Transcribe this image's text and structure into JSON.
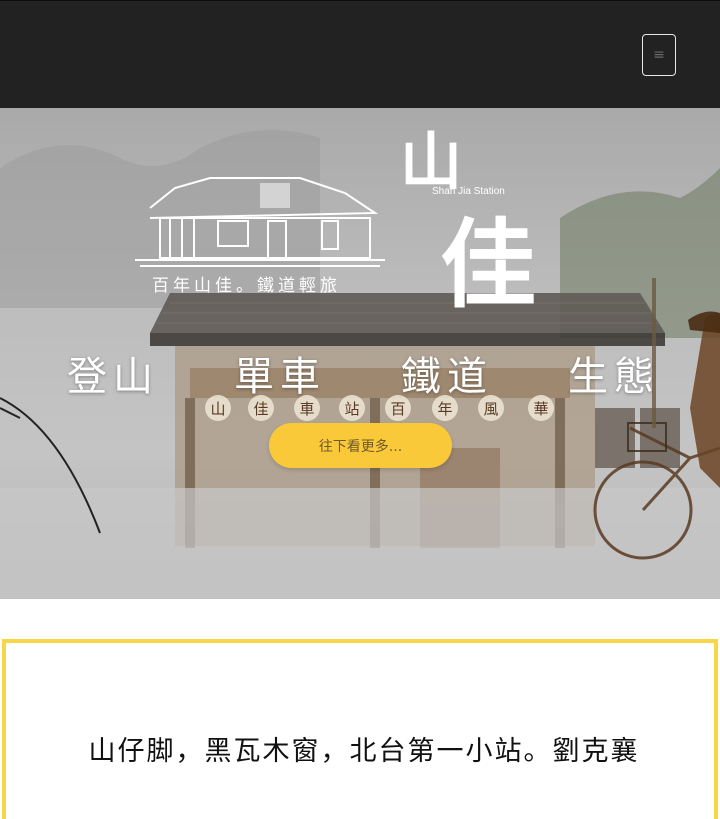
{
  "header": {
    "menu_icon": "hamburger-icon",
    "menu_glyph": "≡"
  },
  "hero": {
    "logo_big_1": "山",
    "logo_big_2": "佳",
    "english_name": "Shan Jia Station",
    "subtitle": "百年山佳。鐵道輕旅",
    "categories": [
      "登山",
      "單車",
      "鐵道",
      "生態"
    ],
    "sign_chars": [
      "山",
      "佳",
      "車",
      "站",
      "百",
      "年",
      "風",
      "華"
    ],
    "more_button": "往下看更多..."
  },
  "intro": {
    "quote": "山仔脚，黑瓦木窗，北台第一小站。劉克襄"
  },
  "colors": {
    "topbar": "#222222",
    "accent_yellow": "#f9c93a",
    "border_yellow": "#f9d54a"
  }
}
